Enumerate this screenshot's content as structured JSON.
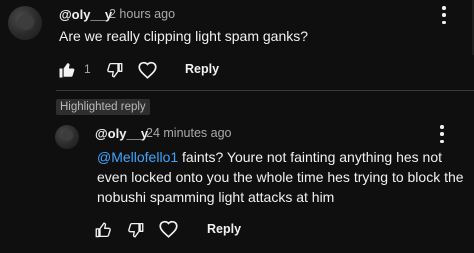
{
  "comment": {
    "author": "@oly__y",
    "time": "2 hours ago",
    "text": "Are we really clipping light spam ganks?",
    "like_count": "1",
    "reply_label": "Reply",
    "icons": [
      "thumbs-up-icon",
      "thumbs-down-icon",
      "heart-icon",
      "more-vert-icon"
    ]
  },
  "highlight": {
    "badge_label": "Highlighted reply"
  },
  "reply": {
    "author": "@oly__y",
    "time": "24 minutes ago",
    "mention": "@Mellofello1",
    "text_line1": " faints? Youre not fainting anything hes not",
    "text_line2": "even locked onto you the whole time hes trying to block the",
    "text_line3": "nobushi spamming light attacks at him",
    "reply_label": "Reply",
    "icons": [
      "thumbs-up-icon",
      "thumbs-down-icon",
      "heart-icon",
      "more-vert-icon"
    ]
  },
  "colors": {
    "background": "#0f0f0f",
    "text": "#f1f1f1",
    "secondary_text": "#aaaaaa",
    "mention": "#3ea6ff",
    "badge_bg": "#2e2e2e"
  }
}
